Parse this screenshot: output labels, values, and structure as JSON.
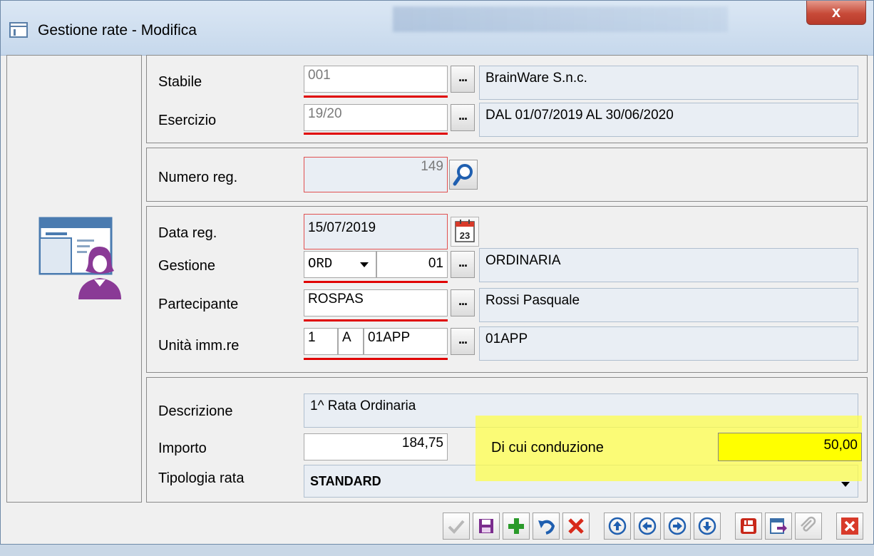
{
  "window": {
    "title": "Gestione rate - Modifica",
    "close_label": "x"
  },
  "stabile": {
    "label": "Stabile",
    "code": "001",
    "description": "BrainWare S.n.c."
  },
  "esercizio": {
    "label": "Esercizio",
    "code": "19/20",
    "description": "DAL 01/07/2019 AL 30/06/2020"
  },
  "numero_reg": {
    "label": "Numero reg.",
    "value": "149"
  },
  "data_reg": {
    "label": "Data reg.",
    "value": "15/07/2019",
    "calendar_day": "23"
  },
  "gestione": {
    "label": "Gestione",
    "type": "ORD",
    "code": "01",
    "description": "ORDINARIA"
  },
  "partecipante": {
    "label": "Partecipante",
    "code": "ROSPAS",
    "description": "Rossi Pasquale"
  },
  "unita": {
    "label": "Unità imm.re",
    "part1": "1",
    "part2": "A",
    "part3": "01APP",
    "description": "01APP"
  },
  "descrizione": {
    "label": "Descrizione",
    "value": "1^ Rata Ordinaria"
  },
  "importo": {
    "label": "Importo",
    "value": "184,75"
  },
  "conduzione": {
    "label": "Di cui conduzione",
    "value": "50,00"
  },
  "tipologia": {
    "label": "Tipologia rata",
    "value": "STANDARD"
  },
  "ellipsis": "...",
  "colors": {
    "highlight": "#ffff46",
    "required_line": "#e00000",
    "avatar_purple": "#8a3a96"
  },
  "toolbar_icons": [
    "check-icon",
    "save-icon",
    "add-icon",
    "undo-icon",
    "delete-icon",
    "arrow-up-icon",
    "arrow-left-icon",
    "arrow-right-icon",
    "arrow-down-icon",
    "youtube-icon",
    "export-icon",
    "attach-icon",
    "close-icon"
  ]
}
